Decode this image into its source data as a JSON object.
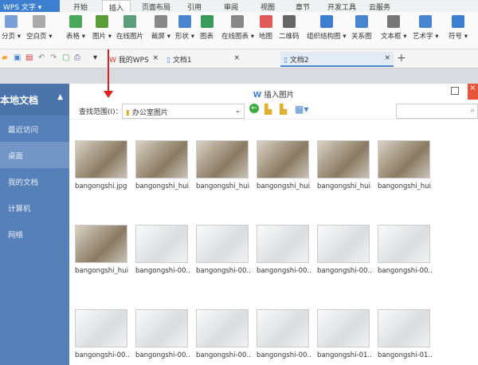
{
  "app": {
    "logo": "WPS 文字"
  },
  "menu_tabs": [
    "开始",
    "插入",
    "页面布局",
    "引用",
    "审阅",
    "视图",
    "章节",
    "开发工具",
    "云服务"
  ],
  "ribbon": [
    "分页 ▾",
    "空白页 ▾",
    "表格 ▾",
    "图片 ▾",
    "在线图片",
    "截屏 ▾",
    "形状 ▾",
    "图表",
    "在线图表 ▾",
    "地图",
    "二维码",
    "组织结构图 ▾",
    "关系图",
    "文本框 ▾",
    "艺术字 ▾",
    "符号 ▾"
  ],
  "doc_tabs": [
    "我的WPS",
    "文档1",
    "文档2"
  ],
  "dialog": {
    "title": "插入图片",
    "look_in_label": "查找范围(I)：",
    "look_in_value": "办公室图片",
    "sidebar_title": "本地文档",
    "sidebar": [
      "最近访问",
      "桌面",
      "我的文档",
      "计算机",
      "网络"
    ],
    "files": [
      "bangongshi.jpg",
      "bangongshi_hui...",
      "bangongshi_hui...",
      "bangongshi_hui...",
      "bangongshi_hui...",
      "bangongshi_hui...",
      "bangongshi_hui...",
      "bangongshi-00...",
      "bangongshi-00...",
      "bangongshi-00...",
      "bangongshi-00...",
      "bangongshi-00...",
      "bangongshi-00...",
      "bangongshi-00...",
      "bangongshi-00...",
      "bangongshi-00...",
      "bangongshi-01...",
      "bangongshi-01..."
    ]
  },
  "colors": {
    "accent": "#3c7fd0",
    "sidebar": "#5580b8",
    "close": "#e8543a",
    "arrow": "#e02020"
  }
}
